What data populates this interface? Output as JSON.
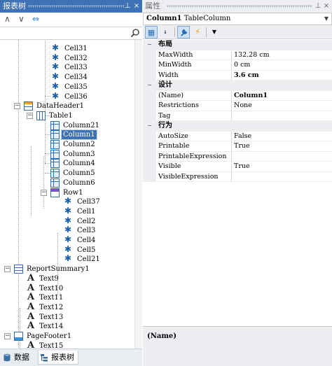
{
  "left_panel": {
    "title": "报表树",
    "pin_glyph": "⊥",
    "close_glyph": "×",
    "toolbar": {
      "collapse_glyph": "∧",
      "expand_glyph": "∨",
      "sync_glyph": "⇔"
    },
    "search": {
      "value": "",
      "placeholder": ""
    },
    "tree_nodes": [
      {
        "label": "Cell31",
        "icon": "cell-icon"
      },
      {
        "label": "Cell32",
        "icon": "cell-icon"
      },
      {
        "label": "Cell33",
        "icon": "cell-icon"
      },
      {
        "label": "Cell34",
        "icon": "cell-icon"
      },
      {
        "label": "Cell35",
        "icon": "cell-icon"
      },
      {
        "label": "Cell36",
        "icon": "cell-icon"
      },
      {
        "label": "DataHeader1",
        "icon": "band-icon",
        "toggle": "−"
      },
      {
        "label": "Table1",
        "icon": "table-icon",
        "toggle": "−"
      },
      {
        "label": "Column21",
        "icon": "column-icon"
      },
      {
        "label": "Column1",
        "icon": "column-icon",
        "selected": true
      },
      {
        "label": "Column2",
        "icon": "column-icon"
      },
      {
        "label": "Column3",
        "icon": "column-icon"
      },
      {
        "label": "Column4",
        "icon": "column-icon"
      },
      {
        "label": "Column5",
        "icon": "column-icon"
      },
      {
        "label": "Column6",
        "icon": "column-icon"
      },
      {
        "label": "Row1",
        "icon": "row-icon",
        "toggle": "−"
      },
      {
        "label": "Cell37",
        "icon": "cell-icon"
      },
      {
        "label": "Cell1",
        "icon": "cell-icon"
      },
      {
        "label": "Cell2",
        "icon": "cell-icon"
      },
      {
        "label": "Cell3",
        "icon": "cell-icon"
      },
      {
        "label": "Cell4",
        "icon": "cell-icon"
      },
      {
        "label": "Cell5",
        "icon": "cell-icon"
      },
      {
        "label": "Cell21",
        "icon": "cell-icon"
      },
      {
        "label": "ReportSummary1",
        "icon": "summary-icon",
        "toggle": "−"
      },
      {
        "label": "Text9",
        "icon": "text-icon"
      },
      {
        "label": "Text10",
        "icon": "text-icon"
      },
      {
        "label": "Text11",
        "icon": "text-icon"
      },
      {
        "label": "Text12",
        "icon": "text-icon"
      },
      {
        "label": "Text13",
        "icon": "text-icon"
      },
      {
        "label": "Text14",
        "icon": "text-icon"
      },
      {
        "label": "PageFooter1",
        "icon": "footer-icon",
        "toggle": "−"
      },
      {
        "label": "Text15",
        "icon": "text-icon"
      }
    ],
    "bottom_tabs": [
      {
        "label": "数据",
        "icon": "database-icon",
        "active": false
      },
      {
        "label": "报表树",
        "icon": "tree-icon",
        "active": true
      }
    ]
  },
  "right_panel": {
    "title": "属性",
    "pin_glyph": "⊥",
    "close_glyph": "×",
    "object_selector": {
      "name": "Column1",
      "type": "TableColumn",
      "arrow": "▼"
    },
    "toolbar": [
      {
        "name": "categorized-button",
        "glyph": "▦",
        "active": true
      },
      {
        "name": "alphabetical-button",
        "glyph": "↓",
        "active": false
      },
      {
        "name": "properties-button",
        "glyph": "🔧",
        "active": true
      },
      {
        "name": "events-button",
        "glyph": "⚡",
        "active": false
      },
      {
        "name": "filter-button",
        "glyph": "▼",
        "active": false
      }
    ],
    "categories": [
      {
        "label": "布局",
        "toggle": "−",
        "rows": [
          {
            "name": "MaxWidth",
            "value": "132.28 cm"
          },
          {
            "name": "MinWidth",
            "value": "0 cm"
          },
          {
            "name": "Width",
            "value": "3.6 cm",
            "bold": true
          }
        ]
      },
      {
        "label": "设计",
        "toggle": "−",
        "rows": [
          {
            "name": "(Name)",
            "value": "Column1",
            "bold": true
          },
          {
            "name": "Restrictions",
            "value": "None"
          },
          {
            "name": "Tag",
            "value": ""
          }
        ]
      },
      {
        "label": "行为",
        "toggle": "−",
        "rows": [
          {
            "name": "AutoSize",
            "value": "False"
          },
          {
            "name": "Printable",
            "value": "True"
          },
          {
            "name": "PrintableExpression",
            "value": ""
          },
          {
            "name": "Visible",
            "value": "True"
          },
          {
            "name": "VisibleExpression",
            "value": ""
          }
        ]
      }
    ],
    "description": {
      "title": "(Name)"
    }
  },
  "colors": {
    "accent": "#3f72b4",
    "selection": "#3f72b4",
    "panel_bg": "#eceef1"
  }
}
